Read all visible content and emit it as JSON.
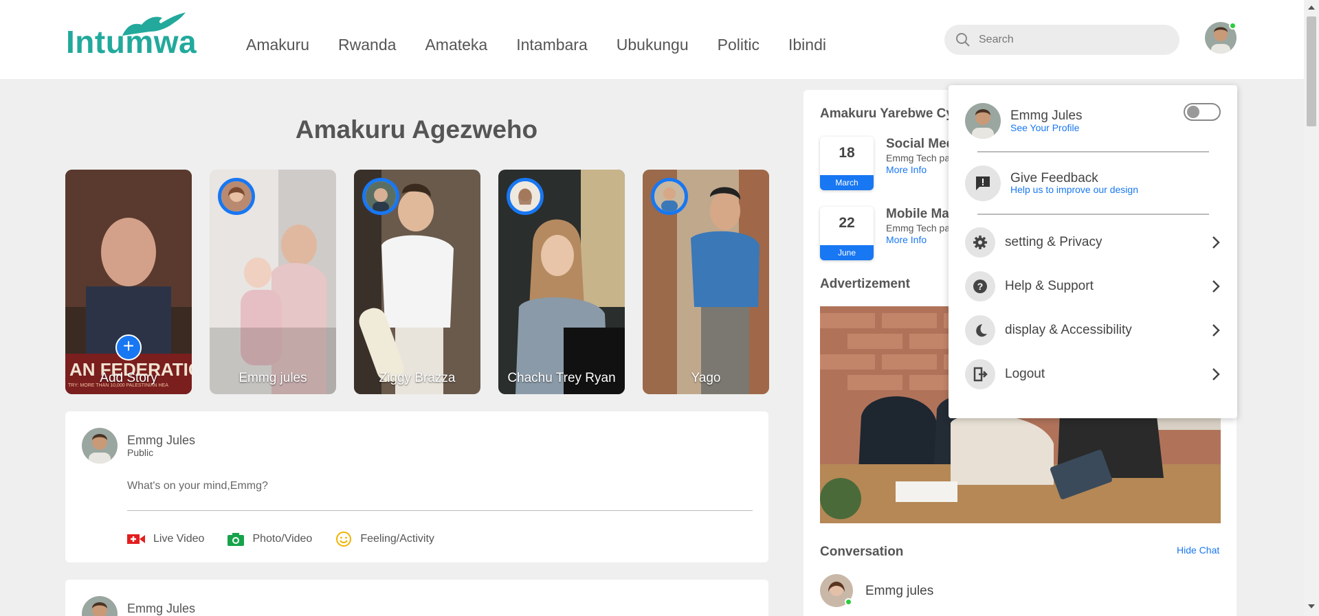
{
  "header": {
    "logo_text": "Intumwa",
    "nav": [
      "Amakuru",
      "Rwanda",
      "Amateka",
      "Intambara",
      "Ubukungu",
      "Politic",
      "Ibindi"
    ],
    "search_placeholder": "Search"
  },
  "main": {
    "title": "Amakuru Agezweho",
    "stories": [
      {
        "name": "Add Story"
      },
      {
        "name": "Emmg jules"
      },
      {
        "name": "Ziggy Brazza"
      },
      {
        "name": "Chachu Trey Ryan"
      },
      {
        "name": "Yago"
      }
    ],
    "story_banner": "AN FEDERATIO",
    "story_banner_small": "TRY: MORE THAN 10,000 PALESTINIAN HEA",
    "composer": {
      "name": "Emmg Jules",
      "privacy": "Public",
      "placeholder": "What's on your mind,Emmg?",
      "actions": [
        "Live Video",
        "Photo/Video",
        "Feeling/Activity"
      ]
    },
    "next_post_name": "Emmg Jules"
  },
  "sidebar": {
    "events_heading": "Amakuru Yarebwe Cy",
    "events": [
      {
        "day": "18",
        "month": "March",
        "title": "Social Med",
        "sub": "Emmg Tech pa",
        "link": "More Info"
      },
      {
        "day": "22",
        "month": "June",
        "title": "Mobile Ma",
        "sub": "Emmg Tech pa",
        "link": "More Info"
      }
    ],
    "ad_heading": "Advertizement",
    "conversation_heading": "Conversation",
    "hide_chat": "Hide Chat",
    "contacts": [
      {
        "name": "Emmg jules"
      }
    ]
  },
  "dropdown": {
    "name": "Emmg Jules",
    "see_profile": "See Your Profile",
    "feedback_title": "Give Feedback",
    "feedback_sub": "Help us to improve our design",
    "items": [
      {
        "label": "setting & Privacy",
        "icon": "gear-icon"
      },
      {
        "label": "Help & Support",
        "icon": "help-icon"
      },
      {
        "label": "display & Accessibility",
        "icon": "moon-icon"
      },
      {
        "label": "Logout",
        "icon": "logout-icon"
      }
    ],
    "dark_mode_on": false
  },
  "colors": {
    "brand": "#22a99c",
    "accent": "#1877f2",
    "online": "#2ecc40"
  }
}
